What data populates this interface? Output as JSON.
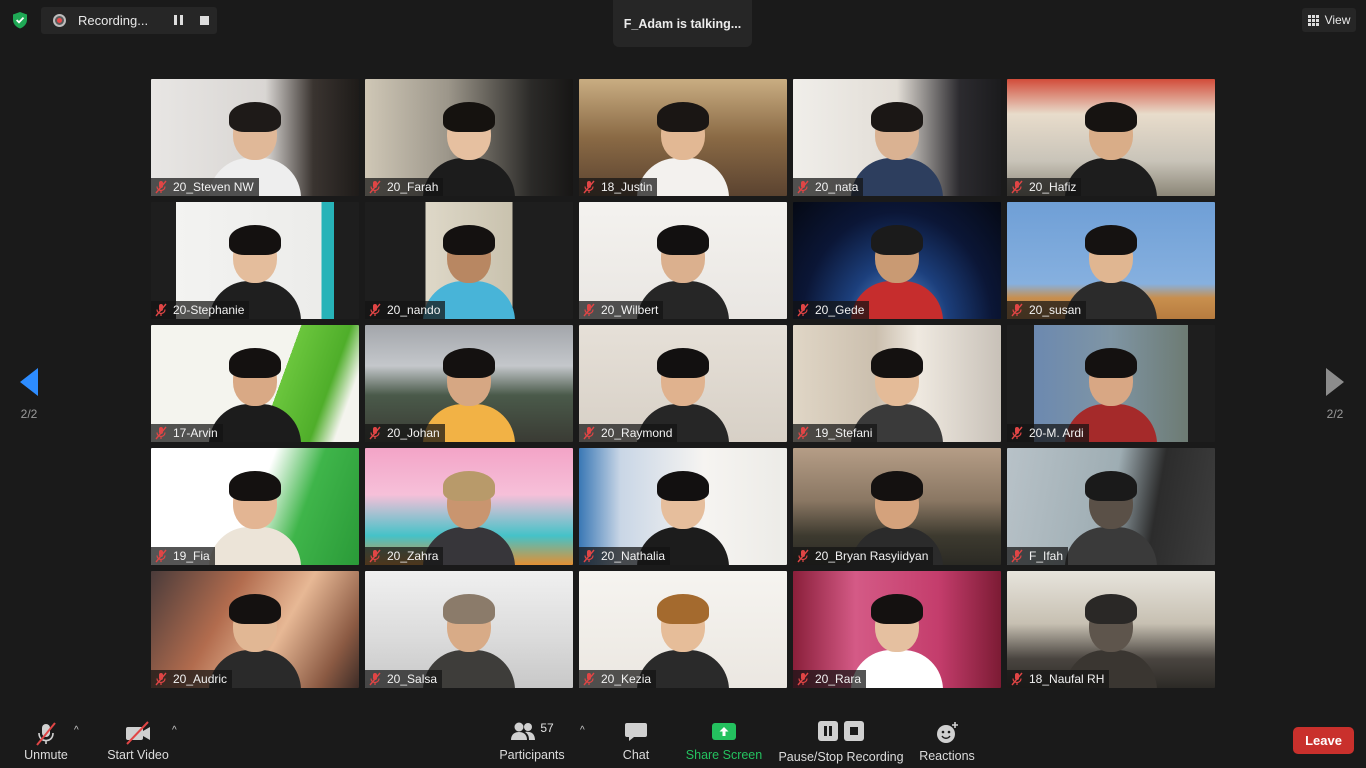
{
  "recording": {
    "label": "Recording..."
  },
  "talking": {
    "text": "F_Adam is talking..."
  },
  "view": {
    "label": "View"
  },
  "page": {
    "left": "2/2",
    "right": "2/2"
  },
  "colors": {
    "accent": "#2d8cff",
    "leave": "#c9302c",
    "share": "#24c15f",
    "muted": "#e04545"
  },
  "participants": [
    "20_Steven NW",
    "20_Farah",
    "18_Justin",
    "20_nata",
    "20_Hafiz",
    "20-Stephanie",
    "20_nando",
    "20_Wilbert",
    "20_Gede",
    "20_susan",
    "17-Arvin",
    "20_Johan",
    "20_Raymond",
    "19_Stefani",
    "20-M. Ardi",
    "19_Fia",
    "20_Zahra",
    "20_Nathalia",
    "20_Bryan Rasyiidyan",
    "F_Ifah",
    "20_Audric",
    "20_Salsa",
    "20_Kezia",
    "20_Rara",
    "18_Naufal RH"
  ],
  "toolbar": {
    "unmute": "Unmute",
    "start_video": "Start Video",
    "participants": "Participants",
    "participants_count": "57",
    "chat": "Chat",
    "share": "Share Screen",
    "record": "Pause/Stop Recording",
    "reactions": "Reactions",
    "leave": "Leave"
  }
}
